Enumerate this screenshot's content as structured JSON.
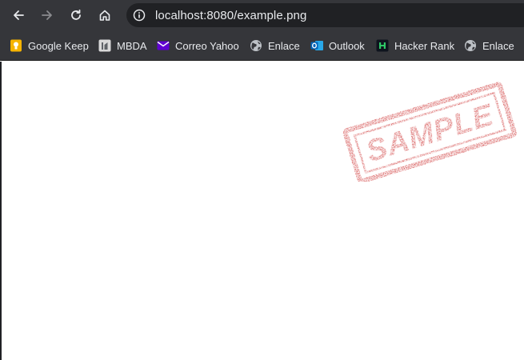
{
  "browser": {
    "url": "localhost:8080/example.png",
    "bookmarks": [
      {
        "label": "Google Keep",
        "icon": "google-keep-icon"
      },
      {
        "label": "MBDA",
        "icon": "mbda-icon"
      },
      {
        "label": "Correo Yahoo",
        "icon": "yahoo-mail-icon"
      },
      {
        "label": "Enlace",
        "icon": "globe-icon"
      },
      {
        "label": "Outlook",
        "icon": "outlook-icon"
      },
      {
        "label": "Hacker Rank",
        "icon": "hackerrank-icon"
      },
      {
        "label": "Enlace",
        "icon": "globe-icon"
      }
    ]
  },
  "image": {
    "stamp_text": "SAMPLE",
    "stamp_color": "#c81e1e"
  },
  "colors": {
    "toolbar": "#35363a",
    "omnibox": "#202124",
    "text": "#e8eaed"
  }
}
